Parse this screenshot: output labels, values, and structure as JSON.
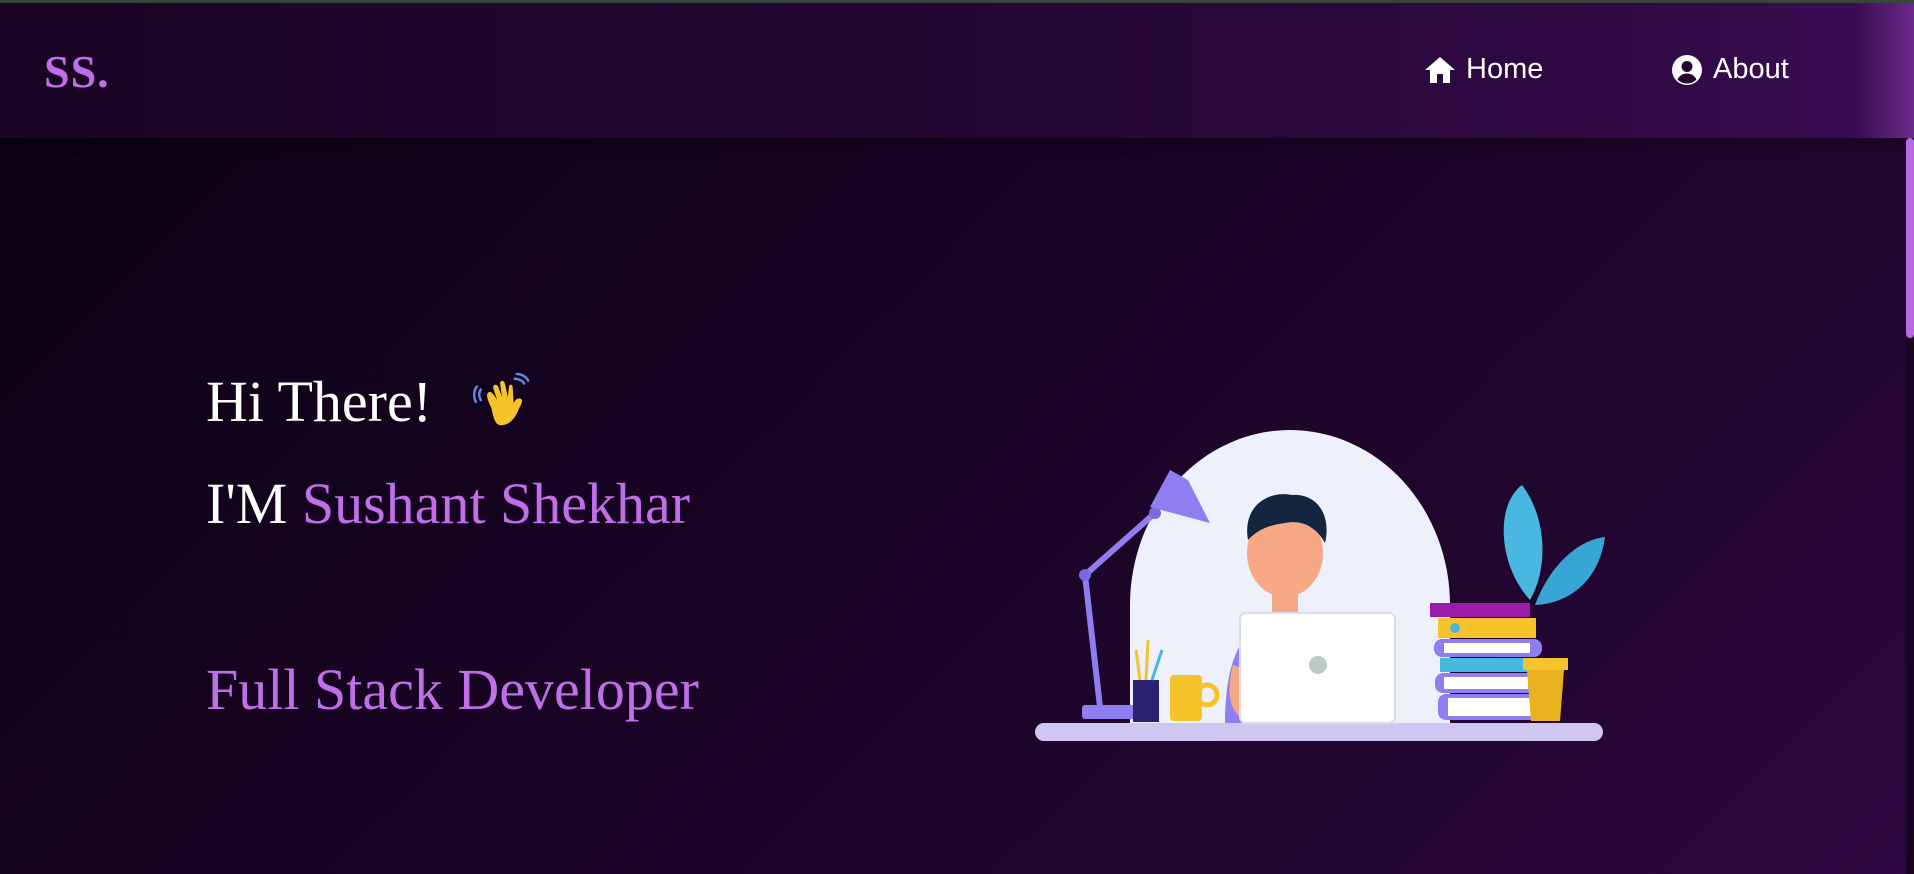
{
  "navbar": {
    "brand": "SS.",
    "links": [
      {
        "label": "Home",
        "icon": "home-icon"
      },
      {
        "label": "About",
        "icon": "user-circle-icon"
      }
    ]
  },
  "hero": {
    "greeting": "Hi There!",
    "greeting_emoji": "waving-hand-icon",
    "intro_prefix": "I'M",
    "name": "Sushant Shekhar",
    "role": "Full Stack Developer",
    "illustration": "developer-at-desk-illustration"
  },
  "colors": {
    "accent": "#c16fe8",
    "background_dark": "#0b0211",
    "background_mid": "#22062f",
    "text": "#ffffff"
  }
}
